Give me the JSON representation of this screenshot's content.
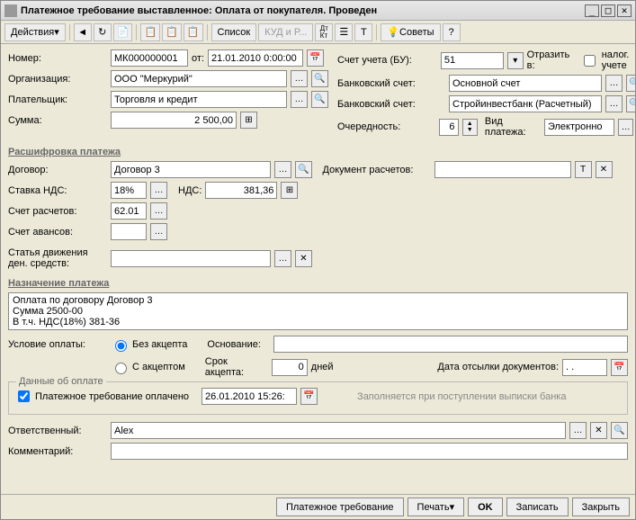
{
  "window": {
    "title": "Платежное требование выставленное: Оплата от покупателя. Проведен"
  },
  "toolbar": {
    "actions": "Действия",
    "list": "Список",
    "kud": "КУД и Р...",
    "tips": "Советы"
  },
  "left": {
    "number_label": "Номер:",
    "number": "МК000000001",
    "from": "от:",
    "date": "21.01.2010 0:00:00",
    "org_label": "Организация:",
    "org": "ООО \"Меркурий\"",
    "payer_label": "Плательщик:",
    "payer": "Торговля и кредит",
    "sum_label": "Сумма:",
    "sum": "2 500,00"
  },
  "right": {
    "account_label": "Счет учета (БУ):",
    "account": "51",
    "reflect_label": "Отразить в:",
    "tax_label": "налог. учете",
    "bank1_label": "Банковский счет:",
    "bank1": "Основной счет",
    "bank2_label": "Банковский счет:",
    "bank2": "Стройинвестбанк (Расчетный)",
    "priority_label": "Очередность:",
    "priority": "6",
    "paytype_label": "Вид платежа:",
    "paytype": "Электронно"
  },
  "decode": {
    "title": "Расшифровка платежа",
    "contract_label": "Договор:",
    "contract": "Договор 3",
    "doc_label": "Документ расчетов:",
    "doc": "",
    "vat_rate_label": "Ставка НДС:",
    "vat_rate": "18%",
    "vat_label": "НДС:",
    "vat": "381,36",
    "calc_acc_label": "Счет расчетов:",
    "calc_acc": "62.01",
    "adv_acc_label": "Счет авансов:",
    "adv_acc": "",
    "movement_label": "Статья движения ден. средств:",
    "movement": ""
  },
  "purpose": {
    "title": "Назначение платежа",
    "text": "Оплата по договору Договор 3\nСумма 2500-00\nВ т.ч. НДС(18%) 381-36"
  },
  "payment": {
    "condition_label": "Условие оплаты:",
    "opt1": "Без акцепта",
    "opt2": "С акцептом",
    "basis_label": "Основание:",
    "basis": "",
    "accept_time_label": "Срок акцепта:",
    "accept_time": "0",
    "days": "дней",
    "docs_date_label": "Дата отсылки документов:",
    "docs_date": ". ."
  },
  "paydata": {
    "title": "Данные об оплате",
    "paid_label": "Платежное требование оплачено",
    "paid_date": "26.01.2010 15:26:",
    "hint": "Заполняется при поступлении выписки банка"
  },
  "bottom": {
    "resp_label": "Ответственный:",
    "resp": "Alex",
    "comment_label": "Комментарий:",
    "comment": ""
  },
  "footer": {
    "req": "Платежное требование",
    "print": "Печать",
    "ok": "OK",
    "save": "Записать",
    "close": "Закрыть"
  }
}
